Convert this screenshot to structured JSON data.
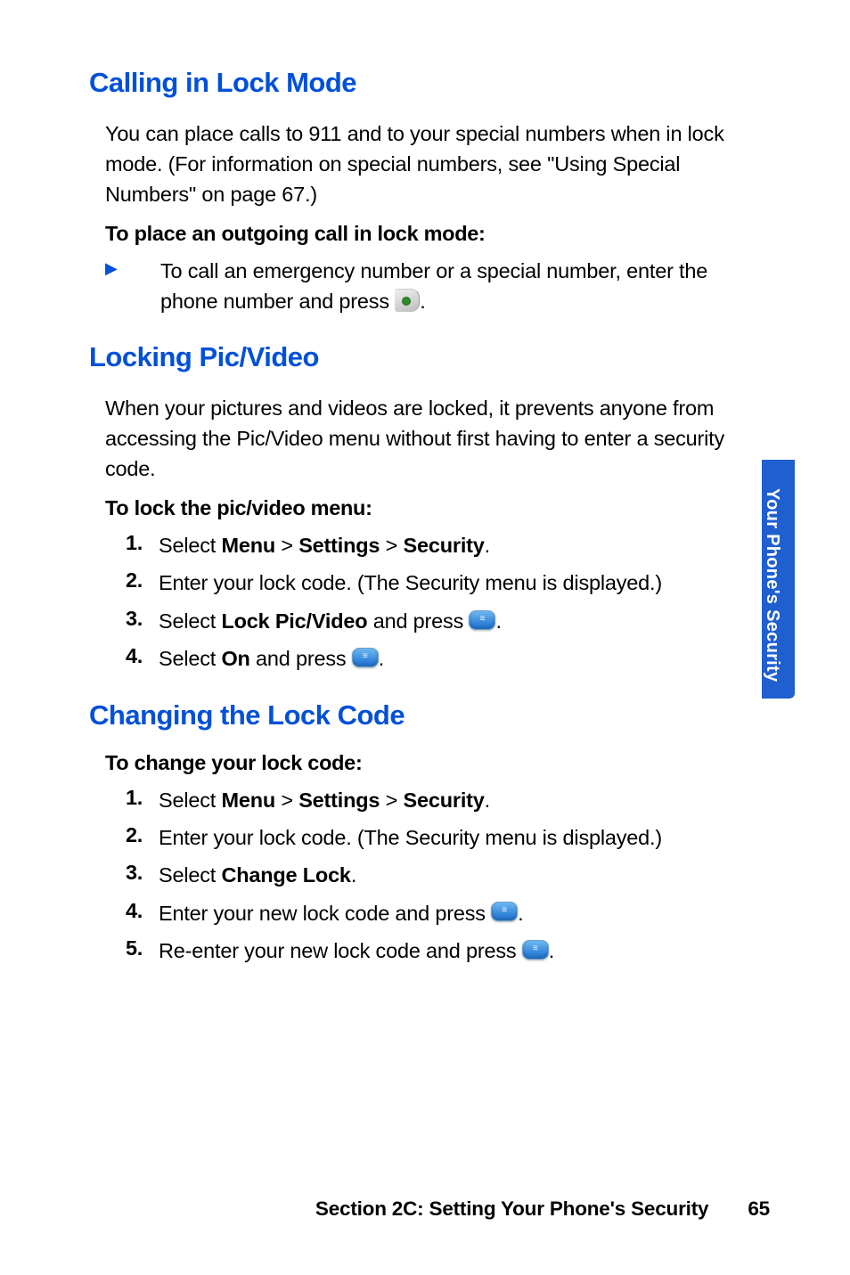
{
  "sidebar_label": "Your Phone's Security",
  "footer": {
    "section": "Section 2C: Setting Your Phone's Security",
    "page": "65"
  },
  "s1": {
    "heading": "Calling in Lock Mode",
    "para": "You can place calls to 911 and to your special numbers when in lock mode. (For information on special numbers, see \"Using Special Numbers\" on page 67.)",
    "subhead": "To place an outgoing call in lock mode:",
    "bullet_pre": "To call an emergency number or a special number, enter the phone number and press ",
    "bullet_post": "."
  },
  "s2": {
    "heading": "Locking Pic/Video",
    "para": "When your pictures and videos are locked, it prevents anyone from accessing the Pic/Video menu without first having to enter a security code.",
    "subhead": "To lock the pic/video menu:",
    "steps": [
      {
        "n": "1.",
        "pre": "Select ",
        "b1": "Menu",
        "mid1": " > ",
        "b2": "Settings",
        "mid2": " > ",
        "b3": "Security",
        "post": "."
      },
      {
        "n": "2.",
        "pre": "Enter your lock code. (The Security menu is displayed.)"
      },
      {
        "n": "3.",
        "pre": "Select ",
        "b1": "Lock Pic/Video",
        "mid1": " and press ",
        "icon": true,
        "post": "."
      },
      {
        "n": "4.",
        "pre": "Select ",
        "b1": "On",
        "mid1": " and press ",
        "icon": true,
        "post": "."
      }
    ]
  },
  "s3": {
    "heading": "Changing the Lock Code",
    "subhead": "To change your lock code:",
    "steps": [
      {
        "n": "1.",
        "pre": "Select ",
        "b1": "Menu",
        "mid1": " > ",
        "b2": "Settings",
        "mid2": " > ",
        "b3": "Security",
        "post": "."
      },
      {
        "n": "2.",
        "pre": "Enter your lock code. (The Security menu is displayed.)"
      },
      {
        "n": "3.",
        "pre": "Select ",
        "b1": "Change Lock",
        "post": "."
      },
      {
        "n": "4.",
        "pre": "Enter your new lock code and press ",
        "icon": true,
        "post": "."
      },
      {
        "n": "5.",
        "pre": "Re-enter your new lock code and press ",
        "icon": true,
        "post": "."
      }
    ]
  }
}
